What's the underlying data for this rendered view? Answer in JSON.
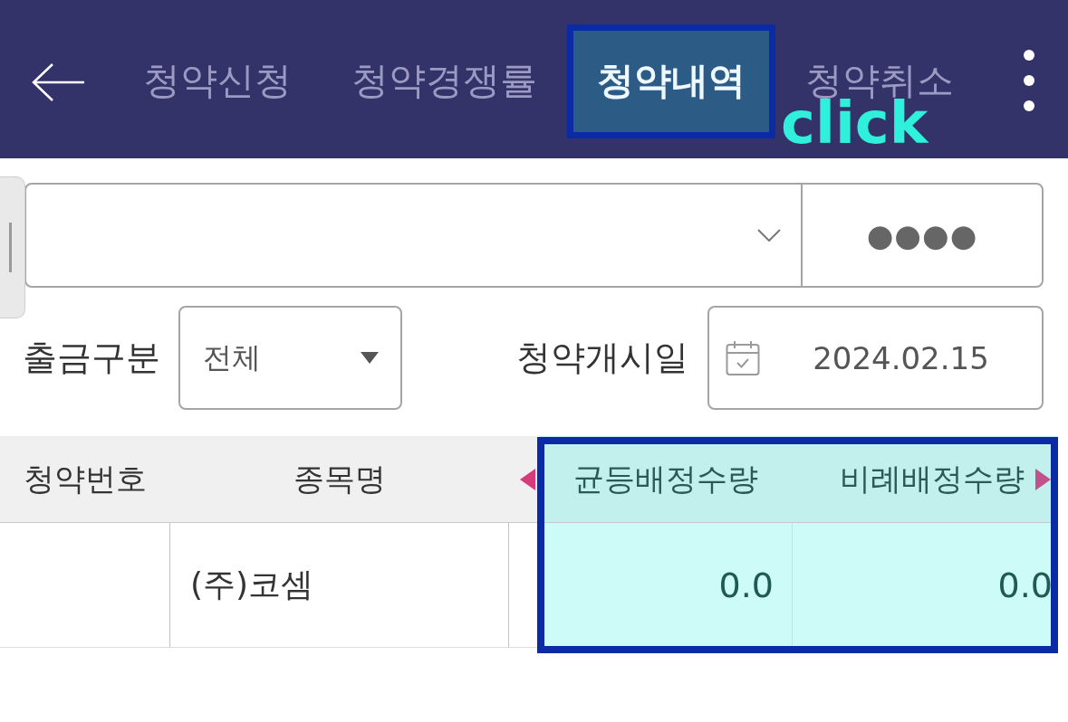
{
  "tabs": [
    {
      "label": "청약신청",
      "selected": false,
      "outlined": false
    },
    {
      "label": "청약경쟁률",
      "selected": false,
      "outlined": false
    },
    {
      "label": "청약내역",
      "selected": true,
      "outlined": true
    },
    {
      "label": "청약취소",
      "selected": false,
      "outlined": false
    }
  ],
  "annotation": {
    "text": "click"
  },
  "account": {
    "password": "●●●●"
  },
  "filters": [
    {
      "kind": "select",
      "label": "출금구분",
      "value": "전체"
    },
    {
      "kind": "date",
      "label": "청약개시일",
      "value": "2024.02.15"
    }
  ],
  "table": {
    "scroll_left": true,
    "scroll_right": true,
    "columns": [
      {
        "label": "청약번호",
        "kind": "text",
        "highlighted": false
      },
      {
        "label": "종목명",
        "kind": "text",
        "highlighted": false
      },
      {
        "label": "균등배정수량",
        "kind": "number",
        "highlighted": true
      },
      {
        "label": "비례배정수량",
        "kind": "number",
        "highlighted": true
      }
    ],
    "rows": [
      {
        "cells": [
          null,
          "(주)코셈",
          "0.0",
          "0.0"
        ]
      }
    ]
  }
}
